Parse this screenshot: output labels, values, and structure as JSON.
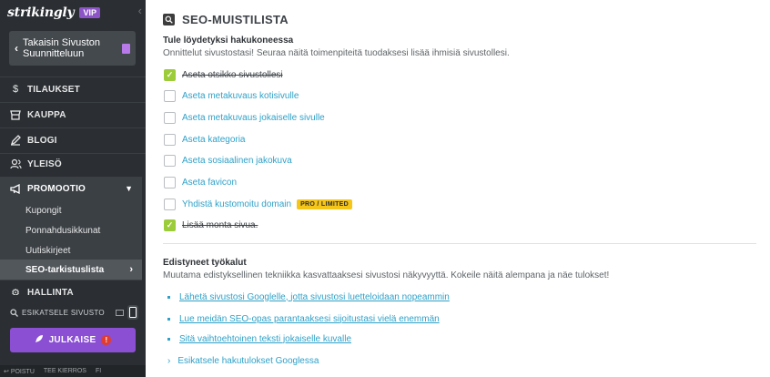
{
  "sidebar": {
    "brand": "strikingly",
    "vip_badge": "VIP",
    "back_label_line1": "Takaisin Sivuston",
    "back_label_line2": "Suunnitteluun",
    "nav": {
      "orders": "TILAUKSET",
      "store": "KAUPPA",
      "blog": "BLOGI",
      "general": "YLEISÖ",
      "promotion": "PROMOOTIO"
    },
    "promotion_items": [
      "Kupongit",
      "Ponnahdusikkunat",
      "Uutiskirjeet",
      "SEO-tarkistuslista"
    ],
    "hidden_nav_label": "HALLINTA",
    "preview_label": "ESIKATSELE SIVUSTO",
    "publish_label": "JULKAISE",
    "publish_alert": "!",
    "bottom_links": [
      "POISTU",
      "TEE KIERROS",
      "FI"
    ]
  },
  "main": {
    "title": "SEO-MUISTILISTA",
    "section1": {
      "heading": "Tule löydetyksi hakukoneessa",
      "description": "Onnittelut sivustostasi! Seuraa näitä toimenpiteitä tuodaksesi lisää ihmisiä sivustollesi."
    },
    "tasks": [
      {
        "label": "Aseta otsikko sivustollesi",
        "done": true
      },
      {
        "label": "Aseta metakuvaus kotisivulle",
        "done": false
      },
      {
        "label": "Aseta metakuvaus jokaiselle sivulle",
        "done": false
      },
      {
        "label": "Aseta kategoria",
        "done": false
      },
      {
        "label": "Aseta sosiaalinen jakokuva",
        "done": false
      },
      {
        "label": "Aseta favicon",
        "done": false
      },
      {
        "label": "Yhdistä kustomoitu domain",
        "done": false,
        "badge": "PRO / LIMITED"
      },
      {
        "label": "Lisää monta sivua.",
        "done": true
      }
    ],
    "section2": {
      "heading": "Edistyneet työkalut",
      "description": "Muutama edistyksellinen tekniikka kasvattaaksesi sivustosi näkyvyyttä. Kokeile näitä alempana ja näe tulokset!"
    },
    "links": [
      "Lähetä sivustosi Googlelle, jotta sivustosi luetteloidaan nopeammin",
      "Lue meidän SEO-opas parantaaksesi sijoitustasi vielä enemmän",
      "Sitä vaihtoehtoinen teksti jokaiselle kuvalle"
    ],
    "google_preview": "Esikatsele hakutulokset Googlessa"
  },
  "colors": {
    "sidebar_bg": "#2b2f33",
    "accent_purple": "#8a4fd3",
    "link_blue": "#2ea1c8",
    "check_green": "#9ccc3a",
    "badge_yellow": "#f5c518"
  }
}
